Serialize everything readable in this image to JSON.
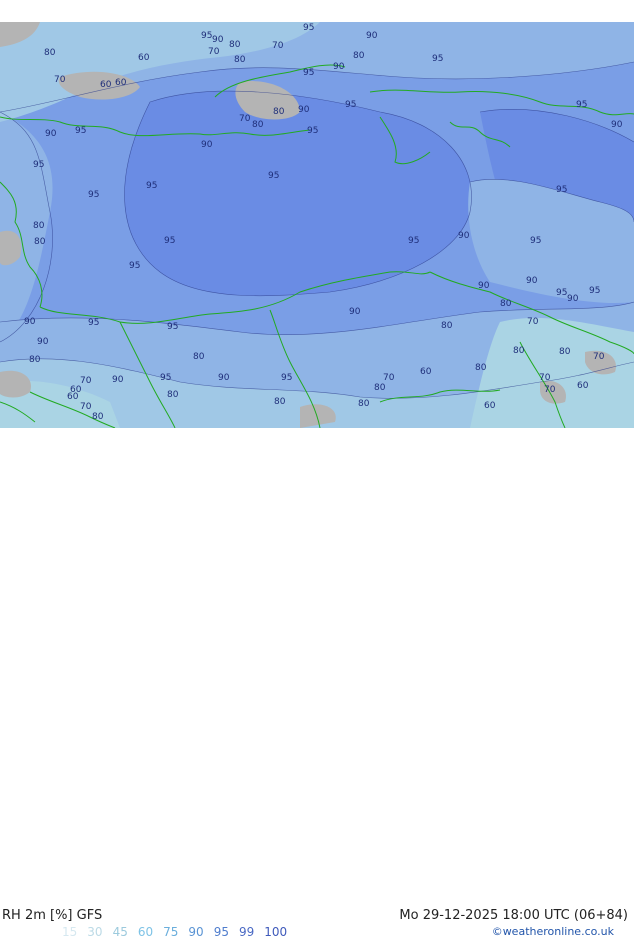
{
  "map": {
    "title": "RH 2m [%] GFS",
    "valid_time": "Mo 29-12-2025 18:00 UTC (06+84)",
    "credit": "©weatheronline.co.uk",
    "legend": [
      {
        "value": "15",
        "color": "#d6e8f0"
      },
      {
        "value": "30",
        "color": "#bcdae6"
      },
      {
        "value": "45",
        "color": "#9ccadd"
      },
      {
        "value": "60",
        "color": "#7ec3e6"
      },
      {
        "value": "75",
        "color": "#6aaedc"
      },
      {
        "value": "90",
        "color": "#5a94d4"
      },
      {
        "value": "95",
        "color": "#4f7dcd"
      },
      {
        "value": "99",
        "color": "#4a69c4"
      },
      {
        "value": "100",
        "color": "#3f5abb"
      }
    ],
    "colors": {
      "land_low": "#b4b4b4",
      "rh_60_70": "#aad4e4",
      "rh_70_80": "#a0c8e6",
      "rh_80_90": "#8fb4e6",
      "rh_90_95": "#7a9ee6",
      "rh_95_99": "#6a8ce4",
      "coastline": "#22aa22",
      "contour": "#2a3a8a"
    },
    "contour_labels": [
      "95",
      "90",
      "80",
      "70",
      "80",
      "60",
      "70",
      "80",
      "60",
      "70",
      "60",
      "95",
      "90",
      "90",
      "95",
      "80",
      "90",
      "70",
      "80",
      "80",
      "95",
      "95",
      "90",
      "90",
      "95",
      "95",
      "90",
      "95",
      "95",
      "95",
      "95",
      "80",
      "95",
      "90",
      "95",
      "95",
      "95",
      "90",
      "95",
      "80",
      "80",
      "90",
      "90",
      "95",
      "90",
      "95",
      "80",
      "95",
      "95",
      "70",
      "95",
      "80",
      "90",
      "90",
      "60",
      "70",
      "80",
      "70",
      "60",
      "80",
      "80",
      "70",
      "80",
      "95",
      "95",
      "70",
      "70",
      "60",
      "90",
      "80",
      "60",
      "90",
      "80",
      "60",
      "70",
      "80",
      "80",
      "80"
    ]
  }
}
